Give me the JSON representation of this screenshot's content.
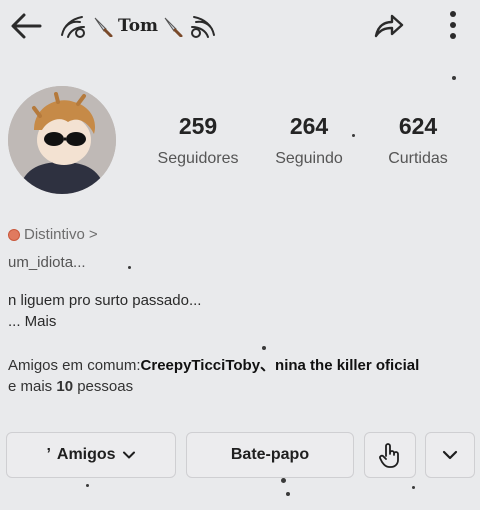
{
  "header": {
    "back_icon": "arrow-left-icon",
    "title": "Tom",
    "share_icon": "share-arrow-icon",
    "more_icon": "vertical-dots-icon"
  },
  "profile": {
    "followers_count": "259",
    "followers_label": "Seguidores",
    "following_count": "264",
    "following_label": "Seguindo",
    "likes_count": "624",
    "likes_label": "Curtidas",
    "badge_text": "Distintivo",
    "badge_chevron": ">",
    "username": "um_idiota...",
    "bio_line1": "n liguem pro surto passado...",
    "bio_line2": "... Mais"
  },
  "mutual": {
    "prefix": "Amigos em comum:",
    "names": "CreepyTicciToby、nina the killer oficial",
    "and_more": "e mais ",
    "count": "10",
    "suffix": " pessoas"
  },
  "actions": {
    "friends_mark": "’",
    "friends_label": "Amigos",
    "chat_label": "Bate-papo",
    "poke_icon": "hand-pointer-icon",
    "expand_icon": "chevron-down-icon"
  },
  "colors": {
    "background": "#e9eaec",
    "badge": "#e07a5f"
  }
}
